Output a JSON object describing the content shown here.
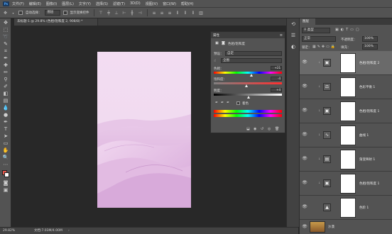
{
  "app": {
    "logo": "Ps"
  },
  "menu": [
    "文件(F)",
    "编辑(E)",
    "图像(I)",
    "图层(L)",
    "文字(Y)",
    "选择(S)",
    "滤镜(T)",
    "3D(D)",
    "视图(V)",
    "窗口(W)",
    "帮助(H)"
  ],
  "options": {
    "auto_select_label": "自动选择：",
    "auto_select_value": "图层",
    "transform_label": "显示变换控件"
  },
  "document": {
    "tab_title": "未标题-1 @ 29.8% (色相/饱和度 2, 908/8) *"
  },
  "status": {
    "zoom": "29.82%",
    "doc_info": "文档:7.03M/4.00M"
  },
  "properties": {
    "title": "属性",
    "adjustment_name": "色相/饱和度",
    "preset_label": "预设：",
    "preset_value": "自定",
    "channel_value": "全图",
    "hue_label": "色相：",
    "hue_value": "+21",
    "hue_level": 0.56,
    "saturation_label": "饱和度：",
    "saturation_value": "-4",
    "saturation_level": 0.48,
    "lightness_label": "明度：",
    "lightness_value": "+4",
    "lightness_level": 0.52,
    "colorize_label": "着色"
  },
  "layers": {
    "tab_label": "图层",
    "kind_label": "类型",
    "blend_mode": "正常",
    "opacity_label": "不透明度：",
    "opacity_value": "100%",
    "lock_label": "锁定：",
    "fill_label": "填充：",
    "fill_value": "100%",
    "items": [
      {
        "name": "色相/饱和度 2",
        "icon": "hue-saturation-icon",
        "selected": true
      },
      {
        "name": "色彩平衡 1",
        "icon": "color-balance-icon",
        "selected": false
      },
      {
        "name": "色相/饱和度 1",
        "icon": "hue-saturation-icon",
        "selected": false
      },
      {
        "name": "曲线 1",
        "icon": "curves-icon",
        "selected": false
      },
      {
        "name": "渐变映射 1",
        "icon": "gradient-map-icon",
        "selected": false
      },
      {
        "name": "色相/饱和度 1",
        "icon": "hue-saturation-icon",
        "selected": false
      },
      {
        "name": "色阶 1",
        "icon": "levels-icon",
        "selected": false
      },
      {
        "name": "沙漠",
        "icon": "image-thumbnail",
        "selected": false
      }
    ]
  },
  "colors": {
    "menubar": "#535353",
    "canvas_bg": "#282828",
    "selected_layer": "#6a6a6a",
    "foreground_swatch": "#e5564b",
    "background_swatch": "#ffffff"
  }
}
